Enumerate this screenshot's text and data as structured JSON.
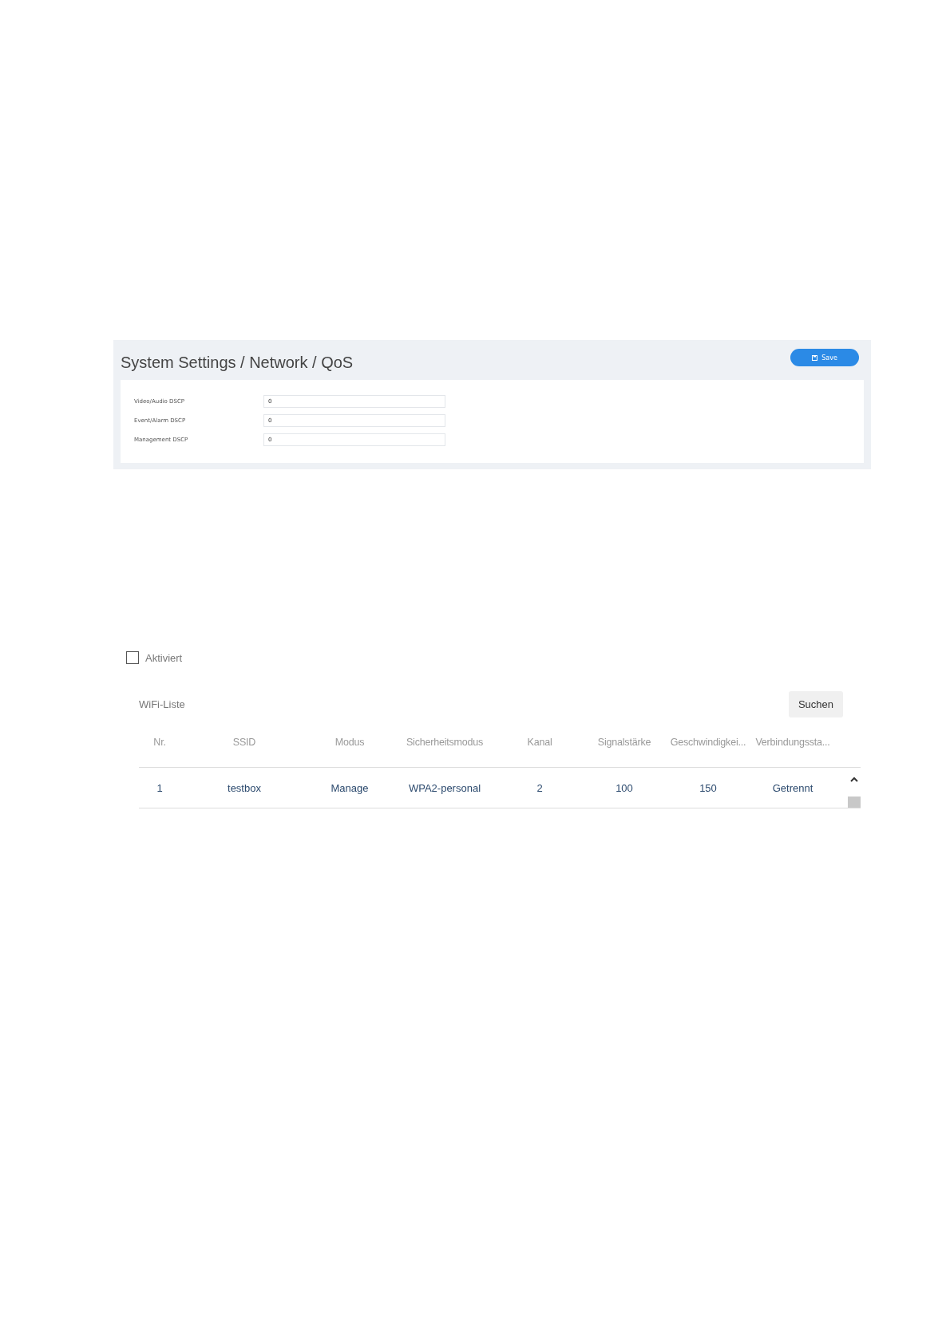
{
  "qos_panel": {
    "title": "System Settings / Network / QoS",
    "save_button": "Save",
    "fields": [
      {
        "label": "Video/Audio DSCP",
        "value": "0"
      },
      {
        "label": "Event/Alarm DSCP",
        "value": "0"
      },
      {
        "label": "Management DSCP",
        "value": "0"
      }
    ]
  },
  "wifi": {
    "enabled": {
      "label": "Aktiviert",
      "checked": false
    },
    "list_title": "WiFi-Liste",
    "search_button": "Suchen",
    "table": {
      "columns": [
        "Nr.",
        "SSID",
        "Modus",
        "Sicherheitsmodus",
        "Kanal",
        "Signalstärke",
        "Geschwindigkei...",
        "Verbindungssta..."
      ],
      "rows": [
        [
          "1",
          "testbox",
          "Manage",
          "WPA2-personal",
          "2",
          "100",
          "150",
          "Getrennt"
        ]
      ]
    }
  }
}
